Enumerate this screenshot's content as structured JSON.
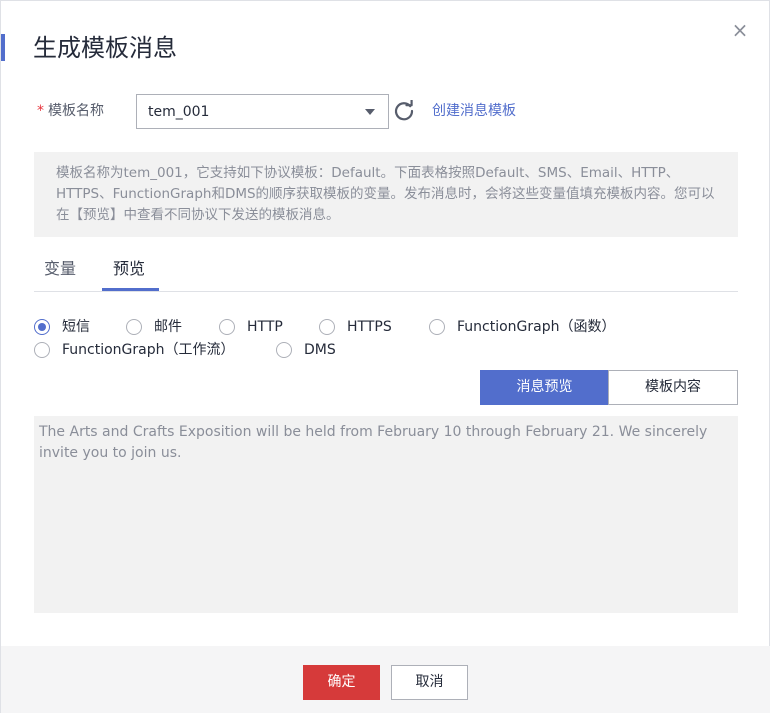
{
  "dialog": {
    "title": "生成模板消息",
    "close_glyph": "×"
  },
  "form": {
    "required_mark": "*",
    "template_name_label": "模板名称",
    "template_select_value": "tem_001",
    "create_link": "创建消息模板"
  },
  "info": {
    "text": "模板名称为tem_001，它支持如下协议模板：Default。下面表格按照Default、SMS、Email、HTTP、HTTPS、FunctionGraph和DMS的顺序获取模板的变量。发布消息时，会将这些变量值填充模板内容。您可以在【预览】中查看不同协议下发送的模板消息。"
  },
  "tabs": [
    {
      "label": "变量",
      "active": false
    },
    {
      "label": "预览",
      "active": true
    }
  ],
  "protocols": {
    "selected": "短信",
    "options": [
      "短信",
      "邮件",
      "HTTP",
      "HTTPS",
      "FunctionGraph（函数）",
      "FunctionGraph（工作流）",
      "DMS"
    ]
  },
  "view_toggle": {
    "preview_label": "消息预览",
    "content_label": "模板内容",
    "active": "消息预览"
  },
  "preview": {
    "text": "The Arts and Crafts Exposition will be held from February 10 through February 21. We sincerely invite you to join us."
  },
  "footer": {
    "ok_label": "确定",
    "cancel_label": "取消"
  },
  "colors": {
    "accent": "#526ecc",
    "danger": "#d63a3a",
    "required": "#e6333c"
  },
  "icons": {
    "close": "close-icon",
    "dropdown": "chevron-down-icon",
    "refresh": "refresh-icon"
  }
}
